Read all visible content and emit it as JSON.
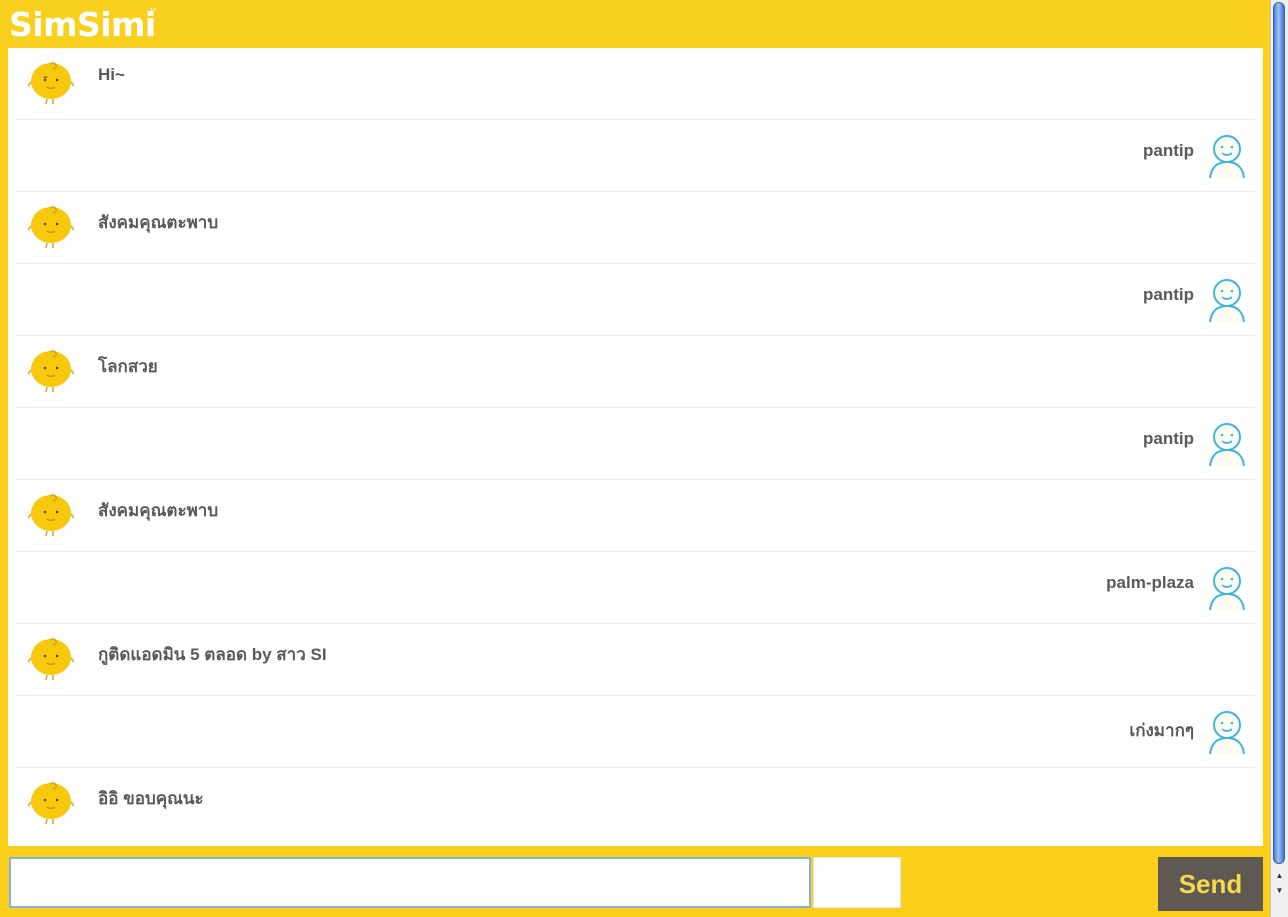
{
  "app": {
    "logo_text": "SimSimi",
    "trademark": "™"
  },
  "messages": [
    {
      "from": "bot",
      "text": "Hi~"
    },
    {
      "from": "user",
      "text": "pantip"
    },
    {
      "from": "bot",
      "text": "สังคมคุณตะพาบ"
    },
    {
      "from": "user",
      "text": "pantip"
    },
    {
      "from": "bot",
      "text": "โลกสวย"
    },
    {
      "from": "user",
      "text": "pantip"
    },
    {
      "from": "bot",
      "text": "สังคมคุณตะพาบ"
    },
    {
      "from": "user",
      "text": "palm-plaza"
    },
    {
      "from": "bot",
      "text": "กูติดแอดมิน 5 ตลอด by สาว SI"
    },
    {
      "from": "user",
      "text": "เก่งมากๆ"
    },
    {
      "from": "bot",
      "text": "อิอิ ขอบคุณนะ"
    }
  ],
  "composer": {
    "value": "",
    "send_label": "Send"
  },
  "colors": {
    "brand_yellow": "#fbcf1a",
    "send_bg": "#5e5a53",
    "send_text": "#f8d94a",
    "user_avatar": "#3fb4e0",
    "bot_avatar": "#f6c80e"
  },
  "icons": {
    "bot": "simsimi-bot-icon",
    "user": "user-smiley-icon"
  }
}
